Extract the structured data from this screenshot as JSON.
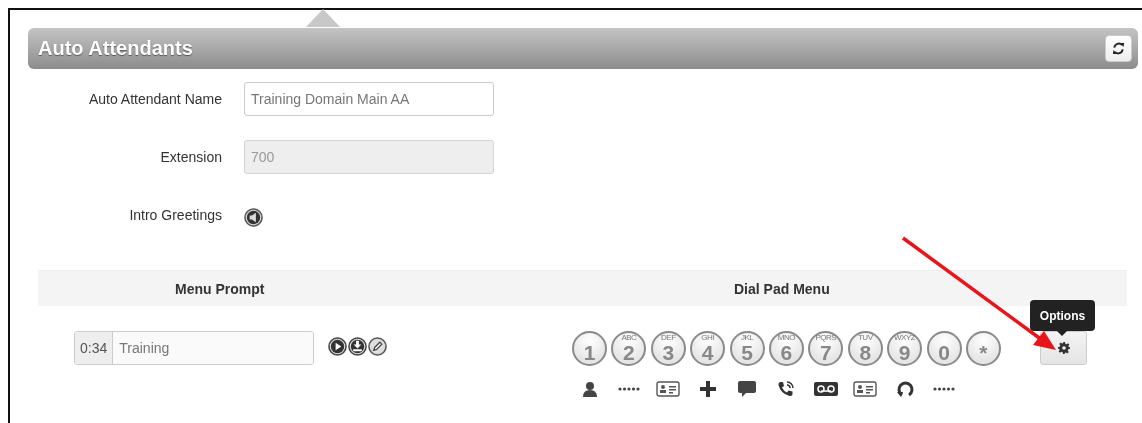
{
  "panel": {
    "title": "Auto Attendants"
  },
  "form": [
    {
      "kind": "text",
      "label": "Auto Attendant Name",
      "value": "Training Domain Main AA",
      "disabled": false
    },
    {
      "kind": "text",
      "label": "Extension",
      "value": "700",
      "disabled": true
    },
    {
      "kind": "audio",
      "label": "Intro Greetings"
    }
  ],
  "table": {
    "columns": [
      "Menu Prompt",
      "Dial Pad Menu"
    ],
    "prompt": {
      "duration": "0:34",
      "name": "Training"
    },
    "dial_keys": [
      {
        "digit": "1",
        "action": {
          "kind": "user"
        }
      },
      {
        "digit": "2",
        "letters": "ABC",
        "action": {
          "kind": "unassigned"
        }
      },
      {
        "digit": "3",
        "letters": "DEF",
        "action": {
          "kind": "directory"
        }
      },
      {
        "digit": "4",
        "letters": "GHI",
        "action": {
          "kind": "add"
        }
      },
      {
        "digit": "5",
        "letters": "JKL",
        "action": {
          "kind": "message"
        }
      },
      {
        "digit": "6",
        "letters": "MNO",
        "action": {
          "kind": "call"
        }
      },
      {
        "digit": "7",
        "letters": "PQRS",
        "action": {
          "kind": "voicemail"
        }
      },
      {
        "digit": "8",
        "letters": "TUV",
        "action": {
          "kind": "directory"
        }
      },
      {
        "digit": "9",
        "letters": "WXYZ",
        "action": {
          "kind": "repeat"
        }
      },
      {
        "digit": "0",
        "action": {
          "kind": "unassigned"
        }
      },
      {
        "digit": "*"
      }
    ],
    "options_tooltip": "Options"
  }
}
